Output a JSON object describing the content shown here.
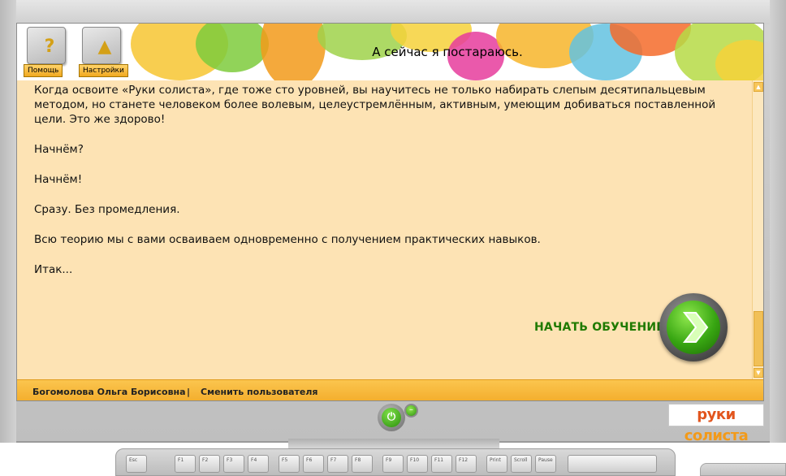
{
  "header": {
    "title": "А сейчас я постараюсь.",
    "help_label": "Помощь",
    "settings_label": "Настройки"
  },
  "content": {
    "paragraphs": [
      "Когда освоите «Руки солиста», где тоже сто уровней, вы научитесь не только набирать слепым десятипальцевым методом, но станете человеком более волевым, целеустремлённым, активным, умеющим добиваться поставленной цели. Это же здорово!",
      "Начнём?",
      "Начнём!",
      "Сразу. Без промедления.",
      "Всю теорию мы с вами осваиваем одновременно с получением практических навыков.",
      "Итак..."
    ],
    "start_label": "НАЧАТЬ ОБУЧЕНИЕ"
  },
  "statusbar": {
    "user_name": "Богомолова Ольга  Борисовна",
    "separator": "|",
    "switch_user_label": "Сменить пользователя"
  },
  "logo": {
    "part1": "руки",
    "part2": "солиста"
  },
  "keyboard": {
    "keys": [
      "Esc",
      "F1",
      "F2",
      "F3",
      "F4",
      "F5",
      "F6",
      "F7",
      "F8",
      "F9",
      "F10",
      "F11",
      "F12",
      "Print",
      "Scroll",
      "Pause"
    ]
  },
  "colors": {
    "content_bg": "#fde3b4",
    "statusbar_bg": "#f3ad2c",
    "start_label": "#1f7a00",
    "accent_green": "#38a612"
  }
}
